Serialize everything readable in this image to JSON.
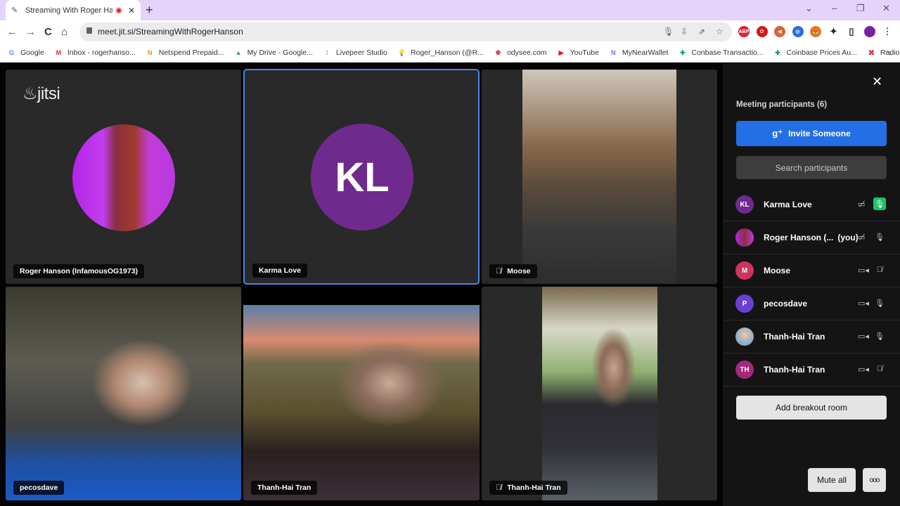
{
  "browser": {
    "tab": {
      "title": "Streaming With Roger Hanson",
      "favicon": "jitsi-feather-icon",
      "recording": true
    },
    "new_tab": "+",
    "window_controls": {
      "tab_search": "⌄",
      "minimize": "–",
      "restore": "❐",
      "close": "✕"
    },
    "nav": {
      "back": "←",
      "forward": "→",
      "reload": "C",
      "home": "⌂"
    },
    "url": "meet.jit.si/StreamingWithRogerHanson",
    "omnibox_icons": [
      "mic-icon",
      "install-icon",
      "share-icon",
      "star-icon"
    ],
    "extensions": [
      {
        "name": "adblock-plus-icon",
        "label": "ABP",
        "color": "#d9243c"
      },
      {
        "name": "opera-icon",
        "label": "O",
        "color": "#d6161d"
      },
      {
        "name": "megaphone-icon",
        "label": "◀",
        "color": "#e06030"
      },
      {
        "name": "target-icon",
        "label": "◎",
        "color": "#2d6be3"
      },
      {
        "name": "metamask-icon",
        "label": "🦊",
        "color": "#e07a2a"
      },
      {
        "name": "puzzle-icon",
        "label": "✦",
        "color": "#222222"
      },
      {
        "name": "sidepanel-icon",
        "label": "▯",
        "color": "#222222"
      },
      {
        "name": "profile-avatar",
        "label": "",
        "color": "#7b1fa2"
      },
      {
        "name": "menu-icon",
        "label": "⋮",
        "color": "#555555"
      }
    ],
    "bookmarks": [
      {
        "label": "Google",
        "icon": "G",
        "color": "#4285f4"
      },
      {
        "label": "Inbox - rogerhanso...",
        "icon": "M",
        "color": "#d93025"
      },
      {
        "label": "Netspend Prepaid...",
        "icon": "N",
        "color": "#f28c28"
      },
      {
        "label": "My Drive - Google...",
        "icon": "▲",
        "color": "#1fa463"
      },
      {
        "label": "Livepeer Studio",
        "icon": "⁞",
        "color": "#3bd671"
      },
      {
        "label": "Roger_Hanson (@R...",
        "icon": "💡",
        "color": "#f4c20d"
      },
      {
        "label": "odysee.com",
        "icon": "✺",
        "color": "#e5415c"
      },
      {
        "label": "YouTube",
        "icon": "▶",
        "color": "#ff0000"
      },
      {
        "label": "MyNearWallet",
        "icon": "N",
        "color": "#6f6cf0"
      },
      {
        "label": "Conbase Transactio...",
        "icon": "✚",
        "color": "#0f9d58"
      },
      {
        "label": "Coinbase Prices Au...",
        "icon": "✚",
        "color": "#0f9d58"
      },
      {
        "label": "RadioPublic Podcas...",
        "icon": "⌘",
        "color": "#c8102e"
      }
    ],
    "bookmarks_more": "»"
  },
  "meeting": {
    "logo_text": "jitsi",
    "tiles": [
      {
        "name": "Roger Hanson (InfamousOG1973)",
        "type": "avatar-image",
        "muted_indicator": false
      },
      {
        "name": "Karma Love",
        "type": "initials",
        "initials": "KL",
        "color": "#6e2b8d",
        "active_speaker": true,
        "muted_indicator": false
      },
      {
        "name": "Moose",
        "type": "video",
        "muted_indicator": true
      },
      {
        "name": "pecosdave",
        "type": "video",
        "muted_indicator": false
      },
      {
        "name": "Thanh-Hai Tran",
        "type": "video",
        "muted_indicator": false
      },
      {
        "name": "Thanh-Hai Tran",
        "type": "video",
        "muted_indicator": true
      }
    ]
  },
  "sidebar": {
    "close": "✕",
    "title": "Meeting participants (6)",
    "invite_label": "Invite Someone",
    "search_placeholder": "Search participants",
    "participants": [
      {
        "name": "Karma Love",
        "suffix": "",
        "initials": "KL",
        "avatar_color": "#6e2b8d",
        "camera": "camera-off-icon",
        "mic": "mic-speaking-icon"
      },
      {
        "name": "Roger Hanson (...",
        "suffix": "(you)",
        "initials": "",
        "avatar_color": "#9b2bd6",
        "camera": "camera-off-icon",
        "mic": "mic-icon"
      },
      {
        "name": "Moose",
        "suffix": "",
        "initials": "M",
        "avatar_color": "#d0335f",
        "camera": "camera-icon",
        "mic": "mic-off-icon"
      },
      {
        "name": "pecosdave",
        "suffix": "",
        "initials": "P",
        "avatar_color": "#6a3fd4",
        "camera": "camera-icon",
        "mic": "mic-icon"
      },
      {
        "name": "Thanh-Hai Tran",
        "suffix": "",
        "initials": "",
        "avatar_color": "#a6b8c8",
        "camera": "camera-icon",
        "mic": "mic-icon"
      },
      {
        "name": "Thanh-Hai Tran",
        "suffix": "",
        "initials": "TH",
        "avatar_color": "#a3297a",
        "camera": "camera-icon",
        "mic": "mic-off-icon"
      }
    ],
    "breakout_label": "Add breakout room",
    "mute_all_label": "Mute all",
    "more_label": "ooo"
  }
}
